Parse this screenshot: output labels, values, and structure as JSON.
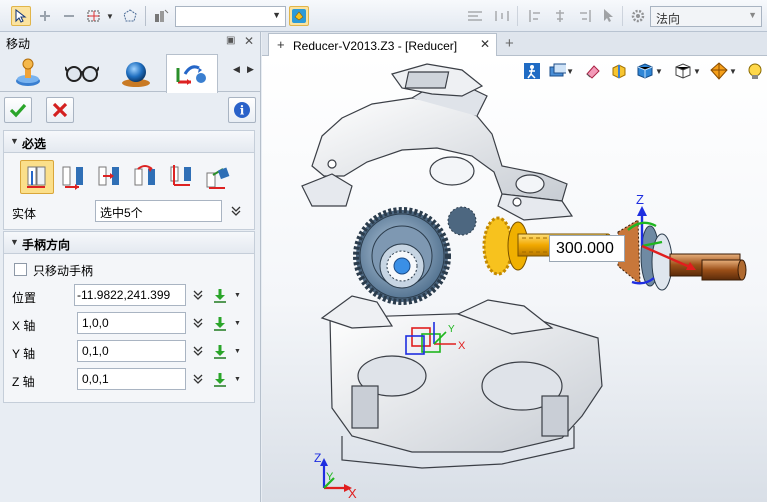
{
  "toolbar": {
    "selection_filter_value": "",
    "view_direction_value": "法向"
  },
  "panel": {
    "title": "移动",
    "tabs": [
      "move-dynamic-icon",
      "glasses-icon",
      "sphere-icon",
      "move-handle-icon"
    ],
    "selected_tab": 3,
    "required_section": {
      "label": "必选",
      "move_types": [
        "move-by-handle-icon",
        "move-point-to-point-icon",
        "move-along-direction-icon",
        "move-rotate-axis-icon",
        "move-align-icon",
        "move-to-coordinate-icon"
      ],
      "selected_move_type": 0,
      "entity_label": "实体",
      "entity_value": "选中5个"
    },
    "handle_section": {
      "label": "手柄方向",
      "only_move_handle_label": "只移动手柄",
      "only_move_handle_checked": false,
      "position_label": "位置",
      "position_value": "-11.9822,241.399",
      "x_axis_label": "X 轴",
      "x_axis_value": "1,0,0",
      "y_axis_label": "Y 轴",
      "y_axis_value": "0,1,0",
      "z_axis_label": "Z 轴",
      "z_axis_value": "0,0,1"
    }
  },
  "document": {
    "tab_title": "Reducer-V2013.Z3 - [Reducer]"
  },
  "viewport": {
    "move_distance": "300.000",
    "handle_axes": {
      "z": "Z",
      "y": "Y",
      "x": "X"
    },
    "world_axes": {
      "z": "Z",
      "y": "Y",
      "x": "X"
    },
    "colors": {
      "x_axis": "#e01e1e",
      "y_axis": "#1fb61f",
      "z_axis": "#1e2ee0",
      "selection": "#f7b800",
      "part_blue": "#6f8aa3"
    }
  }
}
